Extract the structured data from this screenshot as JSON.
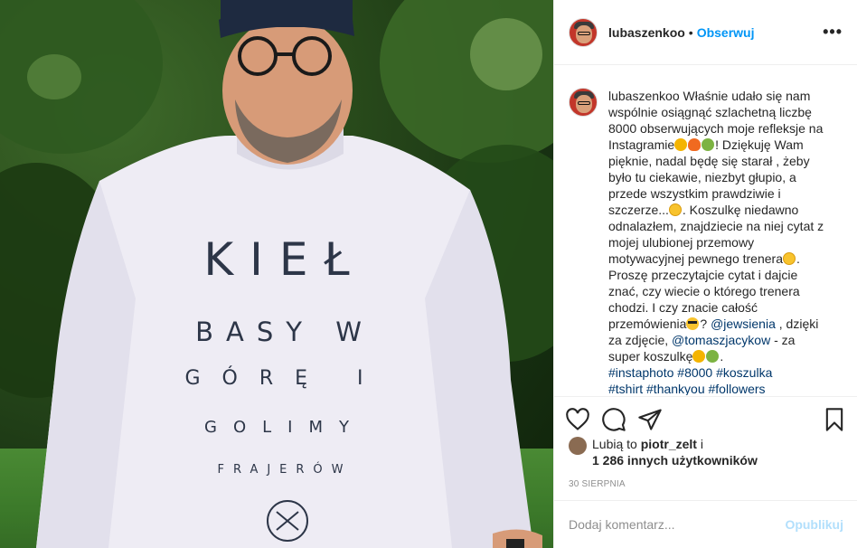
{
  "post": {
    "username": "lubaszenkoo",
    "follow_label": "Obserwuj",
    "dot": "•",
    "more_icon": "more-options-icon"
  },
  "shirt": {
    "line1": "KIEŁ",
    "line2": "BASY W",
    "line3": "GÓRĘ I",
    "line4": "GOLIMY",
    "line5": "FRAJERÓW"
  },
  "caption": {
    "username": "lubaszenkoo",
    "p1": "Właśnie udało się nam wspólnie osiągnąć szlachetną liczbę 8000 obserwujących moje refleksje na Instagramie",
    "p2": "! Dziękuję Wam pięknie, nadal będę się starał , żeby było tu ciekawie, niezbyt głupio, a przede wszystkim prawdziwie i szczerze...",
    "p3": ". Koszulkę niedawno odnalazłem, znajdziecie na niej cytat z mojej ulubionej przemowy motywacyjnej pewnego trenera",
    "p4": ". Proszę przeczytajcie cytat i dajcie znać, czy wiecie o którego trenera chodzi. I czy znacie całość przemówienia",
    "p5": "? ",
    "mention1": "@jewsienia",
    "p6": " , dzięki za zdjęcie, ",
    "mention2": "@tomaszjacykow",
    "p7": " - za super koszulkę",
    "p8": ".",
    "hashtags1": "#instaphoto #8000 #koszulka",
    "hashtags2": "#tshirt #thankyou #followers"
  },
  "actions": {
    "like_icon": "heart-icon",
    "comment_icon": "comment-icon",
    "share_icon": "share-icon",
    "save_icon": "bookmark-icon"
  },
  "likes": {
    "prefix": "Lubią to",
    "user": "piotr_zelt",
    "and": "i",
    "others": "1 286 innych użytkowników"
  },
  "date": "30 SIERPNIA",
  "comment_box": {
    "placeholder": "Dodaj komentarz...",
    "post_label": "Opublikuj"
  },
  "colors": {
    "accent": "#0095f6",
    "link": "#00376b",
    "post_disabled": "#b2dffc",
    "muted": "#8e8e8e"
  }
}
